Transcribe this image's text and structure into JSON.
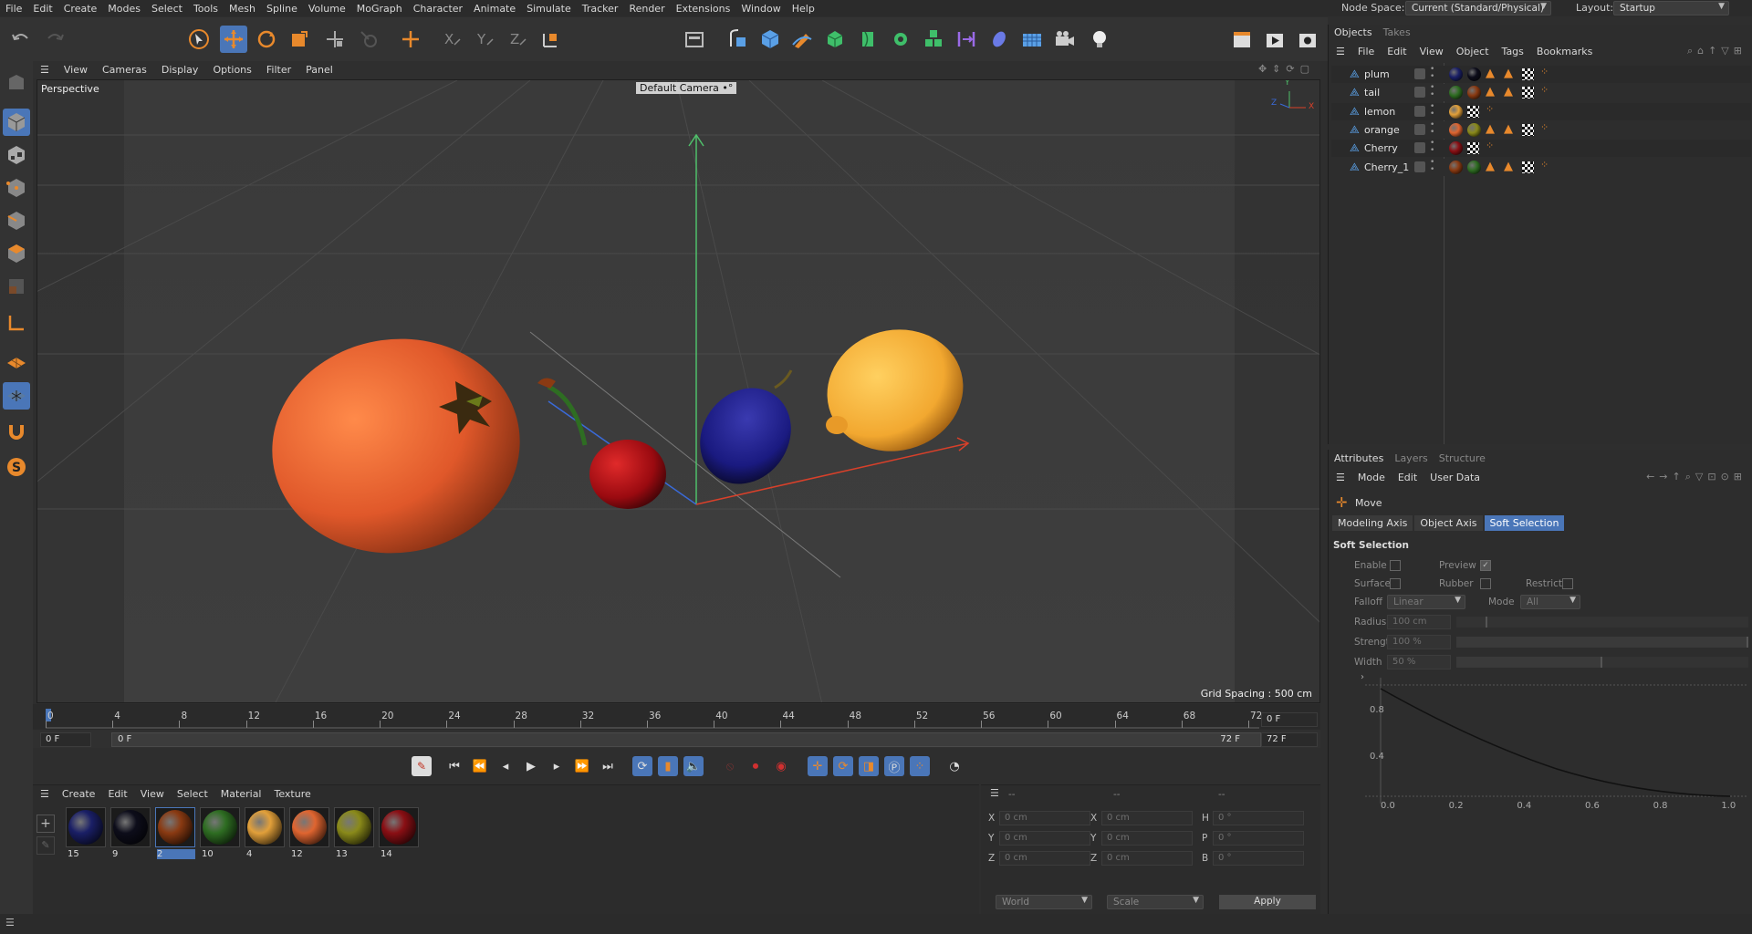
{
  "menubar": {
    "items": [
      "File",
      "Edit",
      "Create",
      "Modes",
      "Select",
      "Tools",
      "Mesh",
      "Spline",
      "Volume",
      "MoGraph",
      "Character",
      "Animate",
      "Simulate",
      "Tracker",
      "Render",
      "Extensions",
      "Window",
      "Help"
    ],
    "node_space_label": "Node Space:",
    "node_space_value": "Current (Standard/Physical)",
    "layout_label": "Layout:",
    "layout_value": "Startup"
  },
  "viewport": {
    "menu": [
      "View",
      "Cameras",
      "Display",
      "Options",
      "Filter",
      "Panel"
    ],
    "projection": "Perspective",
    "camera": "Default Camera",
    "grid_spacing": "Grid Spacing : 500 cm",
    "axis_labels": {
      "x": "X",
      "y": "Y",
      "z": "Z"
    }
  },
  "timeline": {
    "ticks": [
      "0",
      "4",
      "8",
      "12",
      "16",
      "20",
      "24",
      "28",
      "32",
      "36",
      "40",
      "44",
      "48",
      "52",
      "56",
      "60",
      "64",
      "68",
      "72"
    ],
    "current_frame": "0 F",
    "start_frame": "0 F",
    "range_start": "0 F",
    "range_end": "72 F",
    "end_frame": "72 F"
  },
  "objects": {
    "tabs": [
      "Objects",
      "Takes"
    ],
    "menu": [
      "File",
      "Edit",
      "View",
      "Object",
      "Tags",
      "Bookmarks"
    ],
    "rows": [
      {
        "name": "plum",
        "tags": [
          "#1a1f66",
          "#0d0d1a"
        ],
        "extra": true
      },
      {
        "name": "tail",
        "tags": [
          "#2e6d22",
          "#8a3a12"
        ],
        "extra": true
      },
      {
        "name": "lemon",
        "tags": [
          "#e2a03a"
        ],
        "extra": false
      },
      {
        "name": "orange",
        "tags": [
          "#e06530",
          "#8a8a1a"
        ],
        "extra": true
      },
      {
        "name": "Cherry",
        "tags": [
          "#8a0f14"
        ],
        "extra": false
      },
      {
        "name": "Cherry_1",
        "tags": [
          "#8a3a12",
          "#2e6d22"
        ],
        "extra": true
      }
    ]
  },
  "attributes": {
    "tabs": [
      "Attributes",
      "Layers",
      "Structure"
    ],
    "menu": [
      "Mode",
      "Edit",
      "User Data"
    ],
    "tool_name": "Move",
    "subtabs": [
      "Modeling Axis",
      "Object Axis",
      "Soft Selection"
    ],
    "section_title": "Soft Selection",
    "enable_label": "Enable",
    "preview_label": "Preview",
    "surface_label": "Surface",
    "rubber_label": "Rubber",
    "restrict_label": "Restrict",
    "falloff_label": "Falloff",
    "falloff_value": "Linear",
    "mode_label": "Mode",
    "mode_value": "All",
    "radius_label": "Radius",
    "radius_value": "100 cm",
    "strength_label": "Strength",
    "strength_value": "100 %",
    "width_label": "Width",
    "width_value": "50 %",
    "width_fraction": 0.5,
    "graph_y_ticks": [
      "0.8",
      "0.4"
    ],
    "graph_x_ticks": [
      "0.0",
      "0.2",
      "0.4",
      "0.6",
      "0.8",
      "1.0"
    ]
  },
  "materials": {
    "menu": [
      "Create",
      "Edit",
      "View",
      "Select",
      "Material",
      "Texture"
    ],
    "items": [
      {
        "name": "15",
        "color": "#1a1f66"
      },
      {
        "name": "9",
        "color": "#0d0d1a"
      },
      {
        "name": "2",
        "color": "#8a3a12"
      },
      {
        "name": "10",
        "color": "#2e6d22"
      },
      {
        "name": "4",
        "color": "#e2a03a"
      },
      {
        "name": "12",
        "color": "#e06530"
      },
      {
        "name": "13",
        "color": "#8a8a1a"
      },
      {
        "name": "14",
        "color": "#8a0f14"
      }
    ]
  },
  "coordinates": {
    "headers": [
      "--",
      "--",
      "--"
    ],
    "pos": [
      {
        "axis": "X",
        "value": "0 cm"
      },
      {
        "axis": "Y",
        "value": "0 cm"
      },
      {
        "axis": "Z",
        "value": "0 cm"
      }
    ],
    "size": [
      {
        "axis": "X",
        "value": "0 cm"
      },
      {
        "axis": "Y",
        "value": "0 cm"
      },
      {
        "axis": "Z",
        "value": "0 cm"
      }
    ],
    "rot": [
      {
        "axis": "H",
        "value": "0 °"
      },
      {
        "axis": "P",
        "value": "0 °"
      },
      {
        "axis": "B",
        "value": "0 °"
      }
    ],
    "mode1": "World",
    "mode2": "Scale",
    "apply_label": "Apply"
  },
  "colors": {
    "accent": "#4a76b8",
    "orange_icon": "#e8892c"
  }
}
